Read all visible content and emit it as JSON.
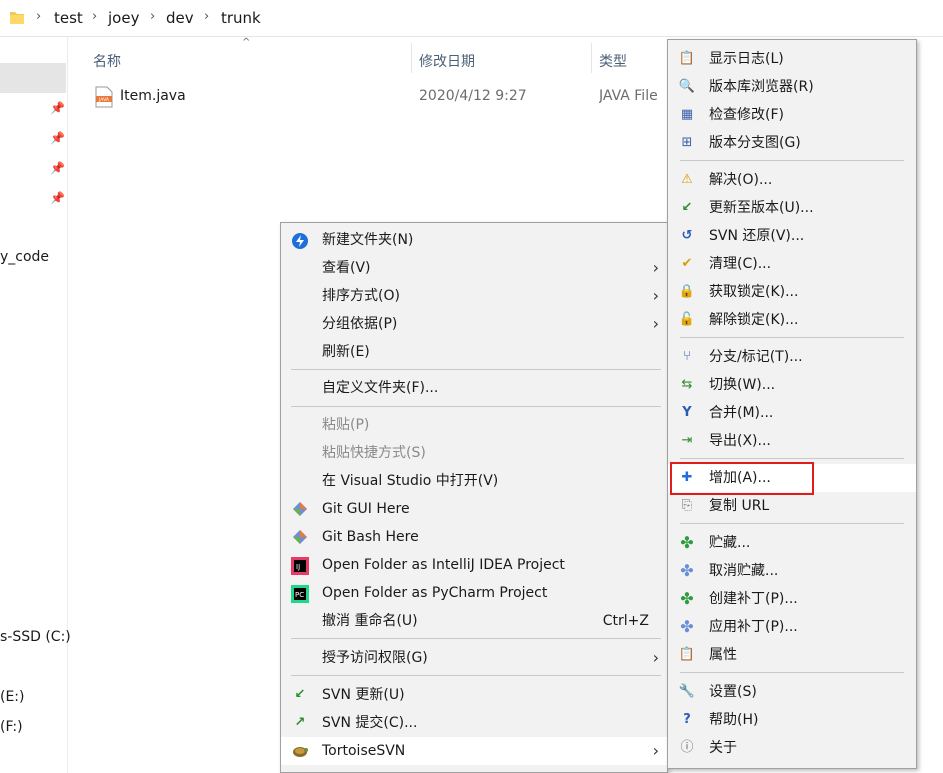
{
  "breadcrumb": [
    "test",
    "joey",
    "dev",
    "trunk"
  ],
  "nav": {
    "items": [
      "y_code",
      "s-SSD (C:)",
      "(E:)",
      "(F:)"
    ]
  },
  "columns": {
    "name": "名称",
    "date": "修改日期",
    "type": "类型"
  },
  "file": {
    "name": "Item.java",
    "date": "2020/4/12 9:27",
    "type": "JAVA File",
    "icon_text": "JAVA"
  },
  "context_menu": {
    "new_folder": "新建文件夹(N)",
    "view": "查看(V)",
    "sort": "排序方式(O)",
    "group": "分组依据(P)",
    "refresh": "刷新(E)",
    "customize": "自定义文件夹(F)...",
    "paste": "粘贴(P)",
    "paste_shortcut": "粘贴快捷方式(S)",
    "open_vs": "在 Visual Studio 中打开(V)",
    "git_gui": "Git GUI Here",
    "git_bash": "Git Bash Here",
    "idea": "Open Folder as IntelliJ IDEA Project",
    "pycharm": "Open Folder as PyCharm Project",
    "undo": "撤消 重命名(U)",
    "undo_shortcut": "Ctrl+Z",
    "access": "授予访问权限(G)",
    "svn_update": "SVN 更新(U)",
    "svn_commit": "SVN 提交(C)...",
    "tortoise": "TortoiseSVN"
  },
  "tortoise_menu": {
    "show_log": "显示日志(L)",
    "repo_browser": "版本库浏览器(R)",
    "check_mod": "检查修改(F)",
    "rev_graph": "版本分支图(G)",
    "resolve": "解决(O)...",
    "update_rev": "更新至版本(U)...",
    "revert": "SVN 还原(V)...",
    "cleanup": "清理(C)...",
    "get_lock": "获取锁定(K)...",
    "release_lock": "解除锁定(K)...",
    "branch_tag": "分支/标记(T)...",
    "switch": "切换(W)...",
    "merge": "合并(M)...",
    "export": "导出(X)...",
    "add": "增加(A)...",
    "copy_url": "复制 URL",
    "shelve": "贮藏...",
    "unshelve": "取消贮藏...",
    "create_patch": "创建补丁(P)...",
    "apply_patch": "应用补丁(P)...",
    "properties": "属性",
    "settings": "设置(S)",
    "help": "帮助(H)",
    "about": "关于"
  },
  "colors": {
    "highlight_box": "#e01c1c",
    "menu_bg": "#f2f2f2",
    "header_text": "#4c607a"
  }
}
